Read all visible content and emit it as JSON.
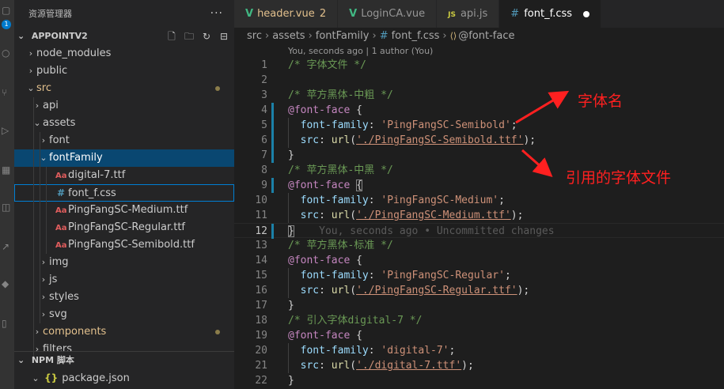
{
  "activity_bar": {
    "badge": "1",
    "icons": [
      "explorer-icon",
      "search-icon",
      "source-control-icon",
      "run-debug-icon",
      "extensions-icon",
      "remote-icon",
      "docker-icon",
      "live-share-icon",
      "database-icon"
    ]
  },
  "sidebar": {
    "title": "资源管理器",
    "more": "···",
    "section": "APPOINTV2",
    "actions": [
      "new-file-icon",
      "new-folder-icon",
      "refresh-icon",
      "collapse-all-icon"
    ],
    "tree": [
      {
        "label": "node_modules",
        "type": "folder",
        "open": false,
        "depth": 1
      },
      {
        "label": "public",
        "type": "folder",
        "open": false,
        "depth": 1
      },
      {
        "label": "src",
        "type": "folder",
        "open": true,
        "depth": 1,
        "modified": true
      },
      {
        "label": "api",
        "type": "folder",
        "open": false,
        "depth": 2
      },
      {
        "label": "assets",
        "type": "folder",
        "open": true,
        "depth": 2
      },
      {
        "label": "font",
        "type": "folder",
        "open": false,
        "depth": 3
      },
      {
        "label": "fontFamily",
        "type": "folder",
        "open": true,
        "depth": 3,
        "selected": true
      },
      {
        "label": "digital-7.ttf",
        "type": "font",
        "depth": 4
      },
      {
        "label": "font_f.css",
        "type": "css",
        "depth": 4,
        "focused": true
      },
      {
        "label": "PingFangSC-Medium.ttf",
        "type": "font",
        "depth": 4
      },
      {
        "label": "PingFangSC-Regular.ttf",
        "type": "font",
        "depth": 4
      },
      {
        "label": "PingFangSC-Semibold.ttf",
        "type": "font",
        "depth": 4
      },
      {
        "label": "img",
        "type": "folder",
        "open": false,
        "depth": 3
      },
      {
        "label": "js",
        "type": "folder",
        "open": false,
        "depth": 3
      },
      {
        "label": "styles",
        "type": "folder",
        "open": false,
        "depth": 3
      },
      {
        "label": "svg",
        "type": "folder",
        "open": false,
        "depth": 3
      },
      {
        "label": "components",
        "type": "folder",
        "open": false,
        "depth": 2,
        "modified": true
      },
      {
        "label": "filters",
        "type": "folder",
        "open": false,
        "depth": 2
      }
    ],
    "npm_section": "NPM 脚本",
    "npm_items": [
      {
        "icon": "{}",
        "label": "package.json"
      }
    ]
  },
  "tabs": [
    {
      "label": "header.vue",
      "icon": "vue",
      "count": "2",
      "modified": true
    },
    {
      "label": "LoginCA.vue",
      "icon": "vue"
    },
    {
      "label": "api.js",
      "icon": "js"
    },
    {
      "label": "font_f.css",
      "icon": "css",
      "active": true,
      "dirty": true
    }
  ],
  "breadcrumbs": [
    "src",
    "assets",
    "fontFamily",
    "font_f.css",
    "@font-face"
  ],
  "codelens": "You, seconds ago | 1 author (You)",
  "code": [
    {
      "n": "1",
      "tokens": [
        [
          "cmt",
          "/* 字体文件 */"
        ]
      ]
    },
    {
      "n": "2",
      "tokens": []
    },
    {
      "n": "3",
      "tokens": [
        [
          "cmt",
          "/* 苹方黑体-中粗 */"
        ]
      ]
    },
    {
      "n": "4",
      "mod": true,
      "tokens": [
        [
          "kw",
          "@font-face"
        ],
        [
          "punc",
          " {"
        ]
      ]
    },
    {
      "n": "5",
      "mod": true,
      "indent": true,
      "tokens": [
        [
          "punc",
          "  "
        ],
        [
          "prop",
          "font-family"
        ],
        [
          "punc",
          ": "
        ],
        [
          "str",
          "'PingFangSC-Semibold'"
        ],
        [
          "punc",
          ";"
        ]
      ]
    },
    {
      "n": "6",
      "mod": true,
      "indent": true,
      "tokens": [
        [
          "punc",
          "  "
        ],
        [
          "prop",
          "src"
        ],
        [
          "punc",
          ": "
        ],
        [
          "fn",
          "url"
        ],
        [
          "punc",
          "("
        ],
        [
          "str link",
          "'./PingFangSC-Semibold.ttf'"
        ],
        [
          "punc",
          ");"
        ]
      ]
    },
    {
      "n": "7",
      "mod": true,
      "tokens": [
        [
          "punc",
          "}"
        ]
      ]
    },
    {
      "n": "8",
      "tokens": [
        [
          "cmt",
          "/* 苹方黑体-中黑 */"
        ]
      ]
    },
    {
      "n": "9",
      "mod": true,
      "tokens": [
        [
          "kw",
          "@font-face"
        ],
        [
          "punc",
          " "
        ],
        [
          "punc bracket-hl",
          "{"
        ]
      ]
    },
    {
      "n": "10",
      "indent": true,
      "tokens": [
        [
          "punc",
          "  "
        ],
        [
          "prop",
          "font-family"
        ],
        [
          "punc",
          ": "
        ],
        [
          "str",
          "'PingFangSC-Medium'"
        ],
        [
          "punc",
          ";"
        ]
      ]
    },
    {
      "n": "11",
      "indent": true,
      "tokens": [
        [
          "punc",
          "  "
        ],
        [
          "prop",
          "src"
        ],
        [
          "punc",
          ": "
        ],
        [
          "fn",
          "url"
        ],
        [
          "punc",
          "("
        ],
        [
          "str link",
          "'./PingFangSC-Medium.ttf'"
        ],
        [
          "punc",
          ");"
        ]
      ]
    },
    {
      "n": "12",
      "mod": true,
      "current": true,
      "tokens": [
        [
          "punc bracket-hl",
          "}"
        ],
        [
          "blame",
          "    You, seconds ago • Uncommitted changes"
        ]
      ]
    },
    {
      "n": "13",
      "tokens": [
        [
          "cmt",
          "/* 苹方黑体-标准 */"
        ]
      ]
    },
    {
      "n": "14",
      "tokens": [
        [
          "kw",
          "@font-face"
        ],
        [
          "punc",
          " {"
        ]
      ]
    },
    {
      "n": "15",
      "indent": true,
      "tokens": [
        [
          "punc",
          "  "
        ],
        [
          "prop",
          "font-family"
        ],
        [
          "punc",
          ": "
        ],
        [
          "str",
          "'PingFangSC-Regular'"
        ],
        [
          "punc",
          ";"
        ]
      ]
    },
    {
      "n": "16",
      "indent": true,
      "tokens": [
        [
          "punc",
          "  "
        ],
        [
          "prop",
          "src"
        ],
        [
          "punc",
          ": "
        ],
        [
          "fn",
          "url"
        ],
        [
          "punc",
          "("
        ],
        [
          "str link",
          "'./PingFangSC-Regular.ttf'"
        ],
        [
          "punc",
          ");"
        ]
      ]
    },
    {
      "n": "17",
      "tokens": [
        [
          "punc",
          "}"
        ]
      ]
    },
    {
      "n": "18",
      "tokens": [
        [
          "cmt",
          "/* 引入字体digital-7 */"
        ]
      ]
    },
    {
      "n": "19",
      "tokens": [
        [
          "kw",
          "@font-face"
        ],
        [
          "punc",
          " {"
        ]
      ]
    },
    {
      "n": "20",
      "indent": true,
      "tokens": [
        [
          "punc",
          "  "
        ],
        [
          "prop",
          "font-family"
        ],
        [
          "punc",
          ": "
        ],
        [
          "str",
          "'digital-7'"
        ],
        [
          "punc",
          ";"
        ]
      ]
    },
    {
      "n": "21",
      "indent": true,
      "tokens": [
        [
          "punc",
          "  "
        ],
        [
          "prop",
          "src"
        ],
        [
          "punc",
          ": "
        ],
        [
          "fn",
          "url"
        ],
        [
          "punc",
          "("
        ],
        [
          "str link",
          "'./digital-7.ttf'"
        ],
        [
          "punc",
          ");"
        ]
      ]
    },
    {
      "n": "22",
      "tokens": [
        [
          "punc",
          "}"
        ]
      ]
    }
  ],
  "annotations": {
    "font_name": "字体名",
    "font_file": "引用的字体文件"
  }
}
